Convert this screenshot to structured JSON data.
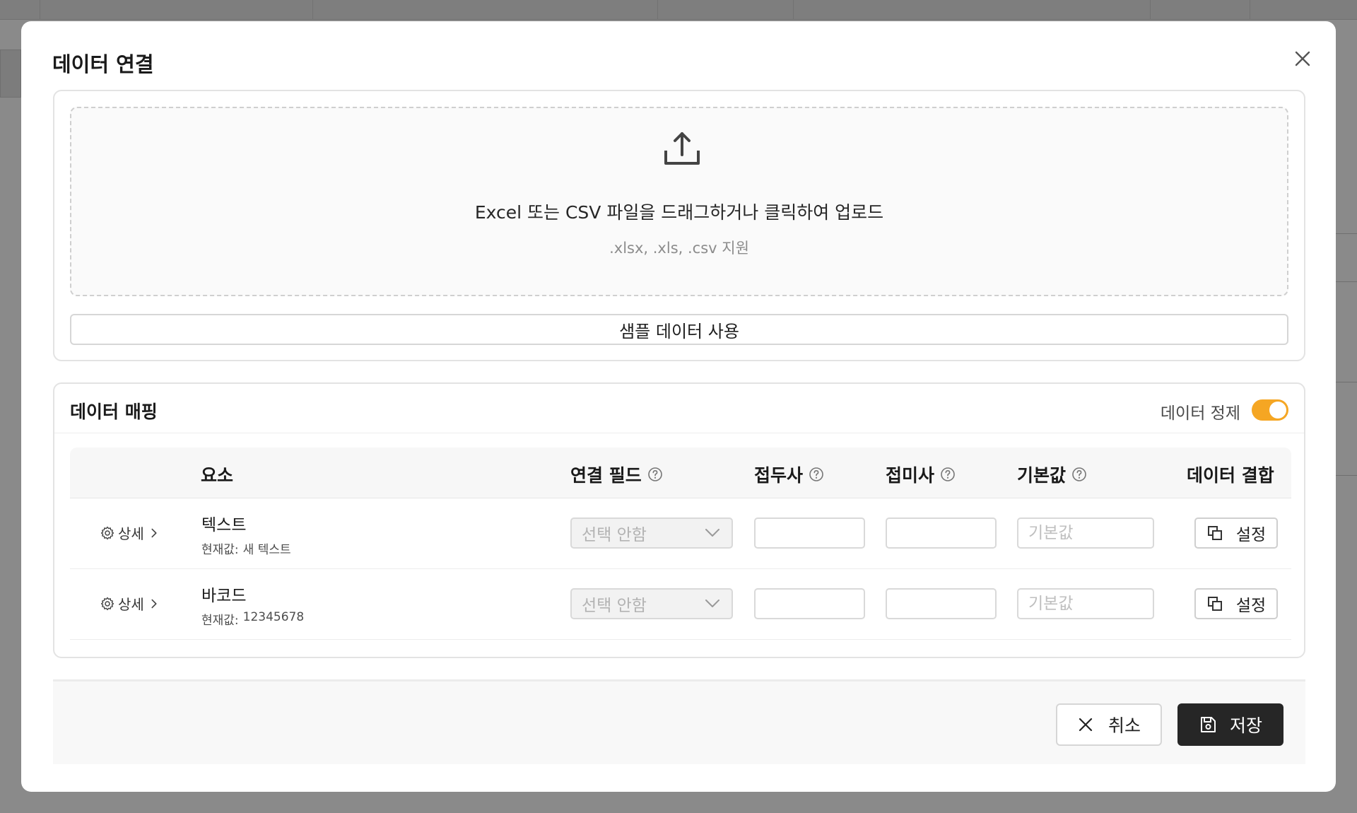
{
  "modal": {
    "title": "데이터 연결"
  },
  "upload": {
    "main_text": "Excel 또는 CSV 파일을 드래그하거나 클릭하여 업로드",
    "sub_text": ".xlsx, .xls, .csv 지원",
    "icon": "upload-icon",
    "sample_button": "샘플 데이터 사용"
  },
  "mapping": {
    "title": "데이터 매핑",
    "refine_label": "데이터 정제",
    "refine_enabled": true,
    "accent_color": "#f5a623",
    "columns": {
      "element": "요소",
      "field": "연결 필드",
      "prefix": "접두사",
      "suffix": "접미사",
      "default": "기본값",
      "combine": "데이터 결합"
    },
    "rows": [
      {
        "detail_label": "상세",
        "name": "텍스트",
        "current_label": "현재값:",
        "current_value": "새 텍스트",
        "field_value": "선택 안함",
        "prefix": "",
        "suffix": "",
        "default_placeholder": "기본값",
        "combine_label": "설정"
      },
      {
        "detail_label": "상세",
        "name": "바코드",
        "current_label": "현재값:",
        "current_value": "12345678",
        "field_value": "선택 안함",
        "prefix": "",
        "suffix": "",
        "default_placeholder": "기본값",
        "combine_label": "설정"
      }
    ]
  },
  "footer": {
    "cancel_label": "취소",
    "save_label": "저장",
    "save_color": "#262626"
  }
}
